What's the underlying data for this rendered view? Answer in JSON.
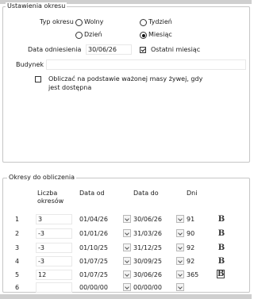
{
  "period": {
    "title": "Ustawienia okresu",
    "type_label": "Typ okresu",
    "options": [
      "Wolny",
      "Tydzień",
      "Dzień",
      "Miesiąc"
    ],
    "selected": "Miesiąc",
    "ref_date_label": "Data odniesienia",
    "ref_date_value": "30/06/26",
    "last_month_label": "Ostatni miesiąc",
    "last_month_checked": true,
    "building_label": "Budynek",
    "building_value": "",
    "weighted_label_line1": "Obliczać na podstawie ważonej masy żywej, gdy",
    "weighted_label_line2": "jest dostępna",
    "weighted_checked": false
  },
  "calc": {
    "title": "Okresy do obliczenia",
    "headers": {
      "count_line1": "Liczba",
      "count_line2": "okresów",
      "date_from": "Data od",
      "date_to": "Data do",
      "days": "Dni"
    },
    "rows": [
      {
        "num": "1",
        "count": "3",
        "from": "01/04/26",
        "to": "30/06/26",
        "days": "91",
        "btn": "B",
        "boxed": false
      },
      {
        "num": "2",
        "count": "-3",
        "from": "01/01/26",
        "to": "31/03/26",
        "days": "90",
        "btn": "B",
        "boxed": false
      },
      {
        "num": "3",
        "count": "-3",
        "from": "01/10/25",
        "to": "31/12/25",
        "days": "92",
        "btn": "B",
        "boxed": false
      },
      {
        "num": "4",
        "count": "-3",
        "from": "01/07/25",
        "to": "30/09/25",
        "days": "92",
        "btn": "B",
        "boxed": false
      },
      {
        "num": "5",
        "count": "12",
        "from": "01/07/25",
        "to": "30/06/26",
        "days": "365",
        "btn": "B",
        "boxed": true
      },
      {
        "num": "6",
        "count": "",
        "from": "00/00/00",
        "to": "00/00/00",
        "days": "",
        "btn": "",
        "boxed": false
      }
    ]
  }
}
